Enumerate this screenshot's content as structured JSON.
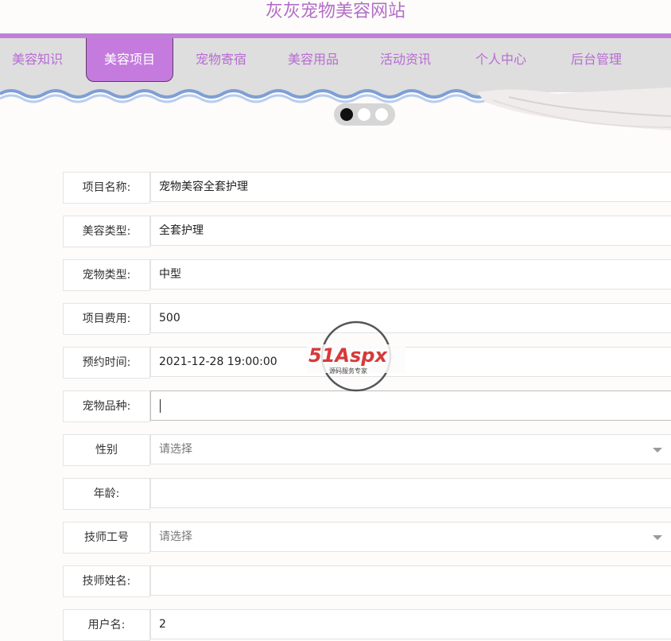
{
  "site": {
    "title": "灰灰宠物美容网站"
  },
  "nav": {
    "items": [
      {
        "label": "美容知识"
      },
      {
        "label": "美容项目",
        "active": true
      },
      {
        "label": "宠物寄宿"
      },
      {
        "label": "美容用品"
      },
      {
        "label": "活动资讯"
      },
      {
        "label": "个人中心"
      },
      {
        "label": "后台管理"
      }
    ]
  },
  "carousel": {
    "slide_count": 3,
    "active_index": 0
  },
  "form": {
    "rows": [
      {
        "label": "项目名称:",
        "value": "宠物美容全套护理"
      },
      {
        "label": "美容类型:",
        "value": "全套护理"
      },
      {
        "label": "宠物类型:",
        "value": "中型"
      },
      {
        "label": "项目费用:",
        "value": "500"
      },
      {
        "label": "预约时间:",
        "value": "2021-12-28 19:00:00"
      },
      {
        "label": "宠物品种:",
        "value": ""
      },
      {
        "label": "性别",
        "value": "请选择"
      },
      {
        "label": "年龄:",
        "value": ""
      },
      {
        "label": "技师工号",
        "value": "请选择"
      },
      {
        "label": "技师姓名:",
        "value": ""
      },
      {
        "label": "用户名:",
        "value": "2"
      }
    ]
  },
  "watermark": {
    "brand": "51Aspx",
    "tagline": "源码服务专家"
  },
  "colors": {
    "accent": "#c47bdd",
    "title": "#b36ec7",
    "nav_bg": "#dedede"
  }
}
